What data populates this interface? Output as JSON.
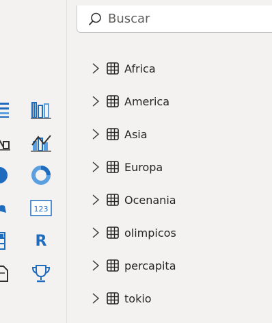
{
  "search": {
    "placeholder": "Buscar"
  },
  "tables": [
    {
      "label": "Africa"
    },
    {
      "label": "America"
    },
    {
      "label": "Asia"
    },
    {
      "label": "Europa"
    },
    {
      "label": "Ocenania"
    },
    {
      "label": "olimpicos"
    },
    {
      "label": "percapita"
    },
    {
      "label": "tokio"
    }
  ],
  "visuals": {
    "icons": [
      "matrix-icon",
      "ribbon-chart-icon",
      "waterfall-chart-icon",
      "combo-chart-icon",
      "filled-map-icon",
      "donut-chart-icon",
      "shape-map-icon",
      "card-icon",
      "table-icon",
      "r-visual-icon",
      "document-icon",
      "trophy-icon"
    ],
    "card_text": "123",
    "r_text": "R"
  },
  "colors": {
    "accent_blue": "#1f6cbf",
    "light_blue": "#5aa0e0",
    "text": "#252423",
    "icon_gray": "#323130"
  }
}
